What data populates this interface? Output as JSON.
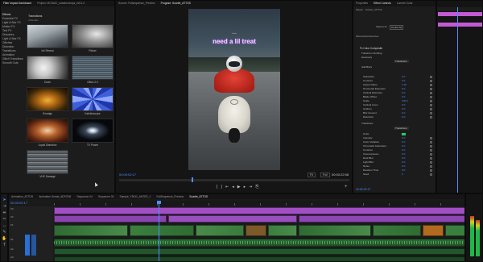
{
  "top_left_tabs": [
    "Filter Impact Dashboard",
    "Project: MOSAIC_sneakerdrops_0v01-2",
    "Project: Sneaker Ads Demos"
  ],
  "source_tabs": [
    "Source: Fullsequence_Preview",
    "Program: Scarlet_ATTOS"
  ],
  "effect_tabs": [
    "Properties",
    "Effect Controls",
    "Lumetri Color",
    "Essential Sound"
  ],
  "effects_browser": {
    "title": "Effects",
    "left_items": [
      "Effects",
      "Essential FX",
      "Light & Blur FX",
      "Motion FX",
      "Text FX",
      "Dissolves",
      "Light & Blur FX",
      "Glitches",
      "Distortion",
      "Transitions",
      "Animation",
      "Glitch Transitions",
      "Smooth Cuts"
    ],
    "header": "Transitions",
    "sub": "4 Results",
    "tiles": [
      "Ink Reveal",
      "Flicker",
      "Zoom",
      "Glitch 2.0",
      "Smudge",
      "Kaleidoscope",
      "Liquid Distortion",
      "TV Power",
      "VHS Damage"
    ]
  },
  "program": {
    "caption_line1": "...",
    "caption_line2": "need a lil treat",
    "timecode_in": "00:00:02:17",
    "fit": "Fit",
    "quality": "Full",
    "timecode_out": "00:00:22:08"
  },
  "effect_controls": {
    "master": "Master · Scarlet_ATTOS",
    "sub_label": "Alignment:",
    "sub_value": "Center All",
    "path": "Show Actual Sources",
    "section": "Fx Color Composite",
    "groups": [
      "Transform Clothing",
      "Geometry",
      "Add Blurs",
      "Transitions"
    ],
    "rows": [
      {
        "n": "Saturation",
        "v": "0.0"
      },
      {
        "n": "Contrast",
        "v": "0.0"
      },
      {
        "n": "Aspect Ratio",
        "v": "1.00"
      },
      {
        "n": "Horizontal Distortion",
        "v": "0.0"
      },
      {
        "n": "Vertical Distortion",
        "v": "0.0"
      },
      {
        "n": "Blade Offset",
        "v": "0.0"
      },
      {
        "n": "Scale",
        "v": "100.0"
      },
      {
        "n": "Vertical Lines",
        "v": "0.0"
      },
      {
        "n": "Uniform",
        "v": "0.0"
      },
      {
        "n": "Blur Amount",
        "v": "0.0"
      },
      {
        "n": "Distortion",
        "v": "0.0"
      },
      {
        "n": "Color",
        "v": ""
      },
      {
        "n": "Intensity",
        "v": "0.0"
      },
      {
        "n": "Color Variation",
        "v": "0.0"
      },
      {
        "n": "Chromatic Aberration",
        "v": "0.0"
      },
      {
        "n": "Contrast",
        "v": "0.0"
      },
      {
        "n": "Overexposure",
        "v": "0.0"
      },
      {
        "n": "Dark Blur",
        "v": "0.0"
      },
      {
        "n": "Light Blur",
        "v": "0.0"
      },
      {
        "n": "Noise",
        "v": "0.0"
      },
      {
        "n": "Random Time",
        "v": "0.0"
      },
      {
        "n": "Seed",
        "v": "0"
      }
    ],
    "labels_right": [
      "Transitions",
      "Transitions"
    ],
    "timecode": "00:00:02:17"
  },
  "timeline": {
    "tabs": [
      "Animation_ATTOS",
      "Animation Sneak_ADFOS6",
      "Sequence 04",
      "Sequence 03",
      "Sample_Y9011_ANTEE_1",
      "FullSequence_Preview",
      "Scarlet_ATTOS"
    ],
    "timecode": "00:00:02:17",
    "tracks": [
      "V3",
      "V2",
      "V1",
      "A1",
      "A2",
      "A3"
    ]
  },
  "colors": {
    "purple": "#9c4fc0",
    "green": "#3b8a3c",
    "orange": "#b26a1f",
    "blue_accent": "#4d8fff",
    "audio": "#2b6b35"
  }
}
